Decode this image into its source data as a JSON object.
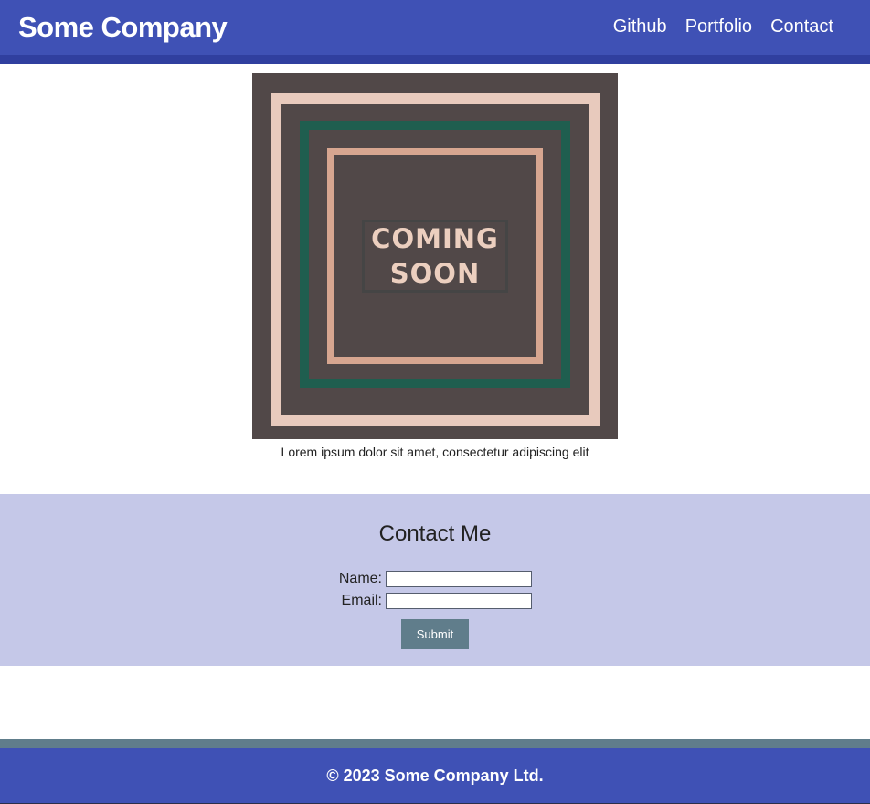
{
  "header": {
    "brand": "Some Company",
    "nav": [
      "Github",
      "Portfolio",
      "Contact"
    ]
  },
  "hero": {
    "image_text_line1": "COMING",
    "image_text_line2": "SOON",
    "caption": "Lorem ipsum dolor sit amet, consectetur adipiscing elit"
  },
  "contact": {
    "title": "Contact Me",
    "name_label": "Name:",
    "name_value": "",
    "email_label": "Email:",
    "email_value": "",
    "submit_label": "Submit"
  },
  "footer": {
    "text": "© 2023 Some Company Ltd."
  },
  "colors": {
    "primary": "#3f51b5",
    "primary_dark": "#303f9f",
    "accent": "#607d8b",
    "contact_bg": "#c5c8e8",
    "image_bg": "#514848"
  }
}
